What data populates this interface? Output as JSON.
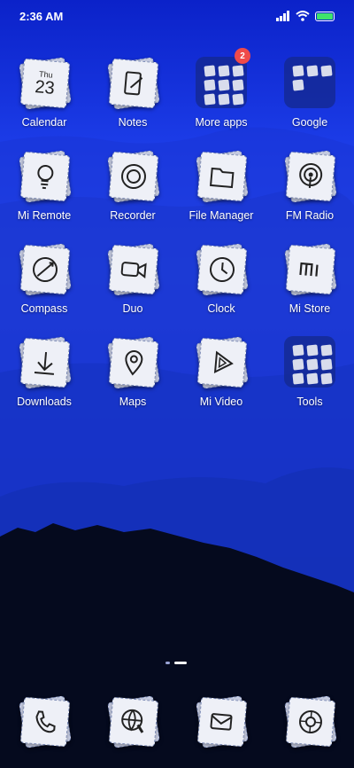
{
  "status": {
    "time": "2:36 AM"
  },
  "apps": [
    {
      "id": "calendar",
      "label": "Calendar",
      "day": "Thu",
      "date": "23"
    },
    {
      "id": "notes",
      "label": "Notes"
    },
    {
      "id": "more_apps",
      "label": "More apps",
      "badge": "2"
    },
    {
      "id": "google",
      "label": "Google"
    },
    {
      "id": "mi_remote",
      "label": "Mi Remote"
    },
    {
      "id": "recorder",
      "label": "Recorder"
    },
    {
      "id": "file_manager",
      "label": "File Manager"
    },
    {
      "id": "fm_radio",
      "label": "FM Radio"
    },
    {
      "id": "compass",
      "label": "Compass"
    },
    {
      "id": "duo",
      "label": "Duo"
    },
    {
      "id": "clock",
      "label": "Clock"
    },
    {
      "id": "mi_store",
      "label": "Mi Store"
    },
    {
      "id": "downloads",
      "label": "Downloads"
    },
    {
      "id": "maps",
      "label": "Maps"
    },
    {
      "id": "mi_video",
      "label": "Mi Video"
    },
    {
      "id": "tools",
      "label": "Tools"
    }
  ],
  "page_indicator": {
    "pages": 2,
    "current": 2
  },
  "dock": [
    {
      "id": "phone",
      "icon": "phone-icon"
    },
    {
      "id": "browser",
      "icon": "globe-icon"
    },
    {
      "id": "messages",
      "icon": "message-icon"
    },
    {
      "id": "camera",
      "icon": "camera-icon"
    }
  ],
  "colors": {
    "badge": "#ef4a4a",
    "battery": "#3fe36b"
  }
}
